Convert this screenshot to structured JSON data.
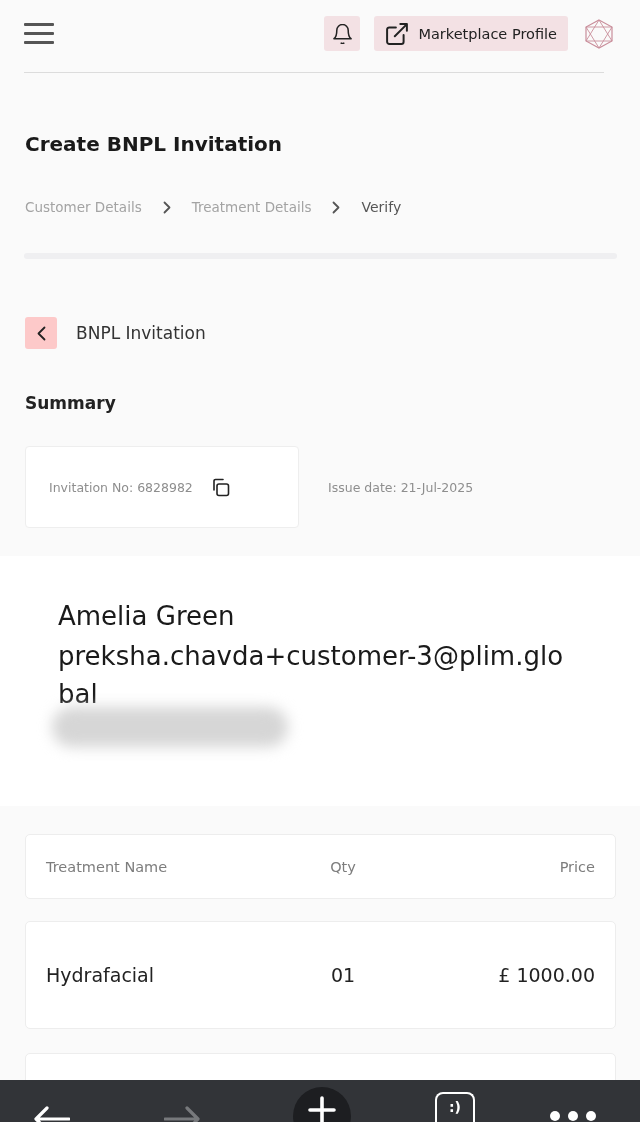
{
  "header": {
    "profile_button": {
      "label": "Marketplace Profile"
    }
  },
  "page": {
    "title": "Create BNPL Invitation",
    "steps": [
      {
        "label": "Customer Details",
        "selected": false
      },
      {
        "label": "Treatment Details",
        "selected": false
      },
      {
        "label": "Verify",
        "selected": true
      }
    ]
  },
  "invitation": {
    "title": "BNPL Invitation"
  },
  "summary": {
    "heading": "Summary",
    "invitation_no": "Invitation No: 6828982",
    "issue_date": "Issue date: 21-Jul-2025"
  },
  "customer": {
    "name": "Amelia Green",
    "email": "preksha.chavda+customer-3@plim.global"
  },
  "table": {
    "columns": [
      "Treatment Name",
      "Qty",
      "Price"
    ],
    "rows": [
      [
        "Hydrafacial",
        "01",
        "£ 1000.00"
      ]
    ]
  },
  "browser_bar": {
    "forward": {
      "disabled": true
    },
    "tabs_button": {
      "label": ":)"
    }
  }
}
